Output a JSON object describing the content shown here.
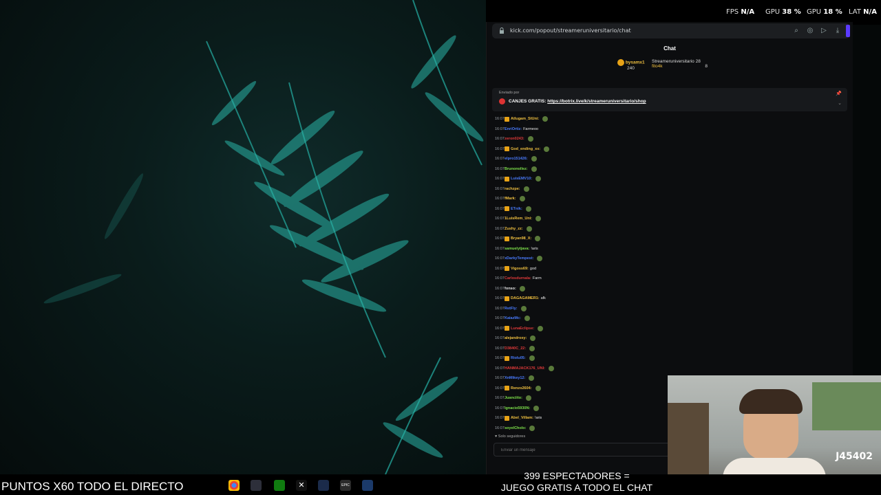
{
  "overlay": {
    "fps_label": "FPS",
    "fps_value": "N/A",
    "gpu1_label": "GPU",
    "gpu1_value": "38 %",
    "gpu2_label": "GPU",
    "gpu2_value": "18 %",
    "lat_label": "LAT",
    "lat_value": "N/A"
  },
  "browser": {
    "url": "kick.com/popout/streameruniversitario/chat"
  },
  "chat": {
    "title": "Chat",
    "leaderboard": [
      {
        "name": "bysamx1",
        "value": "240"
      },
      {
        "name": "Streameruniversitario",
        "value": "28"
      },
      {
        "name": "fito4k",
        "value": "8"
      }
    ],
    "pinned": {
      "sent_by": "Enviado por",
      "prefix": "CANJES GRATIS:",
      "link": "https://botrix.live/k/streameruniversitario/shop"
    },
    "messages": [
      {
        "ts": "16:07",
        "user": "Atlugam_StUni:",
        "color": "#f0c040",
        "text": ""
      },
      {
        "ts": "16:07",
        "user": "EnriOrtiz:",
        "color": "#4a7cff",
        "text": "Farmeoo"
      },
      {
        "ts": "16:07",
        "user": "zeron0243:",
        "color": "#e03a3a",
        "text": ""
      },
      {
        "ts": "16:07",
        "user": "God_ending_xx:",
        "color": "#f0c040",
        "text": ""
      },
      {
        "ts": "16:07",
        "user": "elpro151426:",
        "color": "#4a7cff",
        "text": ""
      },
      {
        "ts": "16:07",
        "user": "Brunonollez:",
        "color": "#7de04a",
        "text": ""
      },
      {
        "ts": "16:07",
        "user": "LuisEMV10:",
        "color": "#4a7cff",
        "text": ""
      },
      {
        "ts": "16:07",
        "user": "rachzpe:",
        "color": "#f0c040",
        "text": ""
      },
      {
        "ts": "16:07",
        "user": "fMark:",
        "color": "#f0c040",
        "text": ""
      },
      {
        "ts": "16:07",
        "user": "ETnik:",
        "color": "#4a7cff",
        "text": ""
      },
      {
        "ts": "16:07",
        "user": "1LuisRem_Uni:",
        "color": "#f0c040",
        "text": ""
      },
      {
        "ts": "16:07",
        "user": "Zushy_zz:",
        "color": "#f0c040",
        "text": ""
      },
      {
        "ts": "16:07",
        "user": "Bryan98_X:",
        "color": "#f0c040",
        "text": ""
      },
      {
        "ts": "16:07",
        "user": "samuelytjava:",
        "color": "#7de04a",
        "text": "!aris"
      },
      {
        "ts": "16:07",
        "user": "xDarkyTempest:",
        "color": "#4a7cff",
        "text": ""
      },
      {
        "ts": "16:07",
        "user": "Vigoss69:",
        "color": "#f0c040",
        "text": "god"
      },
      {
        "ts": "16:07",
        "user": "Carlosdurnala:",
        "color": "#e03a3a",
        "text": "Farm"
      },
      {
        "ts": "16:07",
        "user": "fonso:",
        "color": "#e6e6e6",
        "text": ""
      },
      {
        "ts": "16:07",
        "user": "DAGAGAMER1:",
        "color": "#f0c040",
        "text": "afk"
      },
      {
        "ts": "16:07",
        "user": "RetFly:",
        "color": "#4a7cff",
        "text": ""
      },
      {
        "ts": "16:07",
        "user": "KaiazMc:",
        "color": "#4a7cff",
        "text": ""
      },
      {
        "ts": "16:07",
        "user": "LunaEclipse:",
        "color": "#e03a3a",
        "text": ""
      },
      {
        "ts": "16:07",
        "user": "alejandroxy:",
        "color": "#f0c040",
        "text": ""
      },
      {
        "ts": "16:07",
        "user": "D3840C_22:",
        "color": "#e03a3a",
        "text": ""
      },
      {
        "ts": "16:07",
        "user": "Riolu05:",
        "color": "#4a7cff",
        "text": ""
      },
      {
        "ts": "16:07",
        "user": "HANMAJACK176_UNI:",
        "color": "#e03a3a",
        "text": ""
      },
      {
        "ts": "16:07",
        "user": "XnMikey12:",
        "color": "#4a7cff",
        "text": ""
      },
      {
        "ts": "16:07",
        "user": "Renzo2604:",
        "color": "#f0c040",
        "text": ""
      },
      {
        "ts": "16:07",
        "user": "Juanciito:",
        "color": "#7de04a",
        "text": ""
      },
      {
        "ts": "16:07",
        "user": "Ignacio5930N:",
        "color": "#7de04a",
        "text": ""
      },
      {
        "ts": "16:07",
        "user": "Abel_Villam:",
        "color": "#f0c040",
        "text": "!aris"
      },
      {
        "ts": "16:07",
        "user": "soyelCholo:",
        "color": "#7de04a",
        "text": ""
      }
    ],
    "followers_only": "Solo seguidores",
    "input_placeholder": "Enviar un mensaje"
  },
  "stream": {
    "banner_left": "PUNTOS X60 TODO EL DIRECTO",
    "banner_right_line1": "399 ESPECTADORES =",
    "banner_right_line2": "JUEGO GRATIS A TODO EL CHAT",
    "webcam_code": "J45402"
  }
}
